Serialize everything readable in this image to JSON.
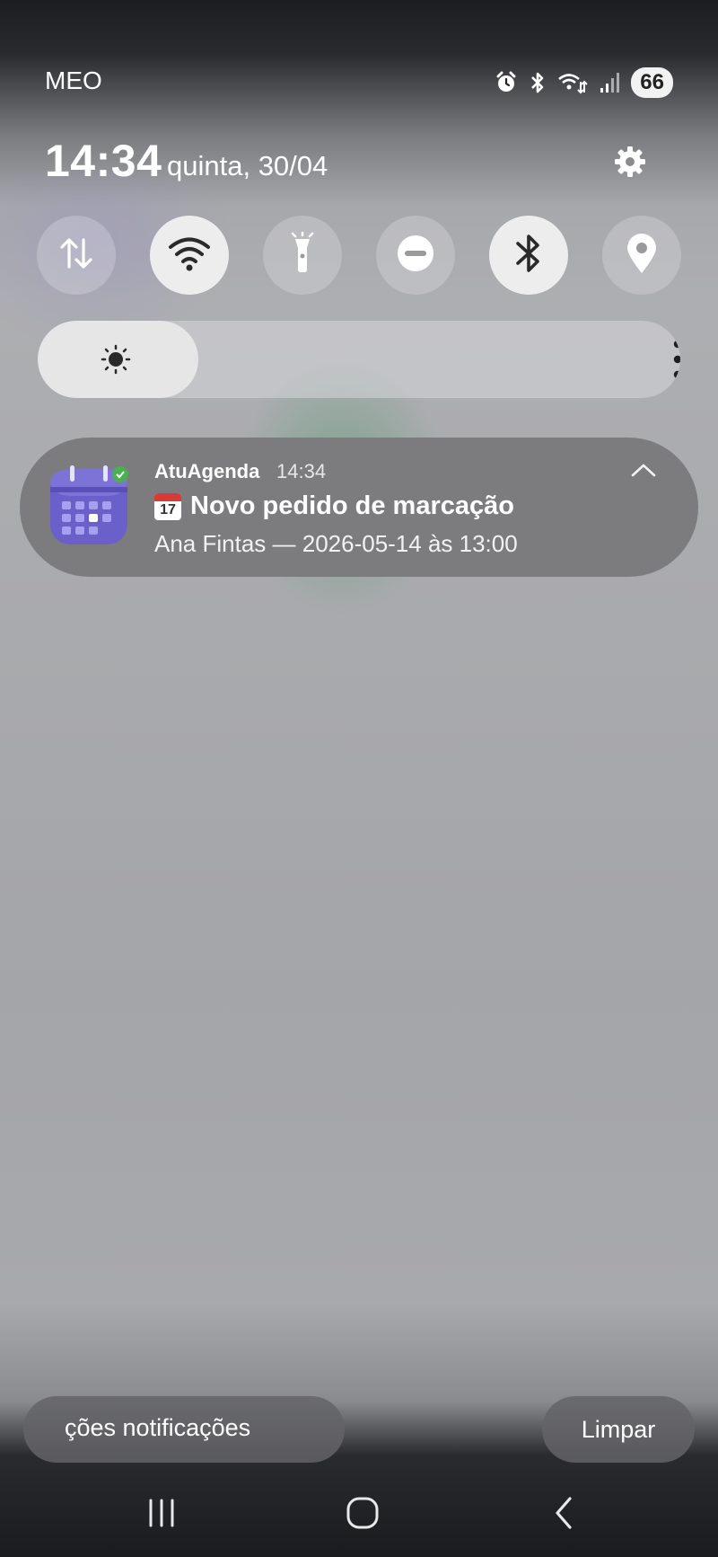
{
  "status_bar": {
    "carrier": "MEO",
    "battery": "66",
    "icons": [
      "alarm-icon",
      "bluetooth-icon",
      "wifi-data-icon",
      "signal-icon",
      "battery-icon"
    ]
  },
  "header": {
    "time": "14:34",
    "date": "quinta, 30/04",
    "settings_icon": "gear-icon"
  },
  "quick_tiles": [
    {
      "name": "mobile-data",
      "icon": "data-arrows-icon",
      "active": false
    },
    {
      "name": "wifi",
      "icon": "wifi-icon",
      "active": true
    },
    {
      "name": "flashlight",
      "icon": "flashlight-icon",
      "active": false
    },
    {
      "name": "do-not-disturb",
      "icon": "do-not-disturb-icon",
      "active": false
    },
    {
      "name": "bluetooth",
      "icon": "bluetooth-icon",
      "active": true
    },
    {
      "name": "location",
      "icon": "location-pin-icon",
      "active": false
    }
  ],
  "brightness": {
    "level": 0.25,
    "icon": "sun-icon",
    "more_icon": "more-vertical-icon"
  },
  "notification": {
    "app_name": "AtuAgenda",
    "time": "14:34",
    "title": "Novo pedido de marcação",
    "title_emoji": "17",
    "body": "Ana Fintas — 2026-05-14 às 13:00",
    "app_icon": "calendar-app-icon",
    "expand_icon": "chevron-up-icon"
  },
  "bottom_buttons": {
    "settings_label": "ções notificações",
    "clear_label": "Limpar"
  },
  "nav_bar": {
    "icons": [
      "recents-icon",
      "home-icon",
      "back-icon"
    ]
  },
  "colors": {
    "tile_active": "#ededee",
    "notification_bg": "#7c7c7e",
    "app_icon_purple": "#6b5fc9",
    "app_icon_badge": "#4caf50"
  }
}
